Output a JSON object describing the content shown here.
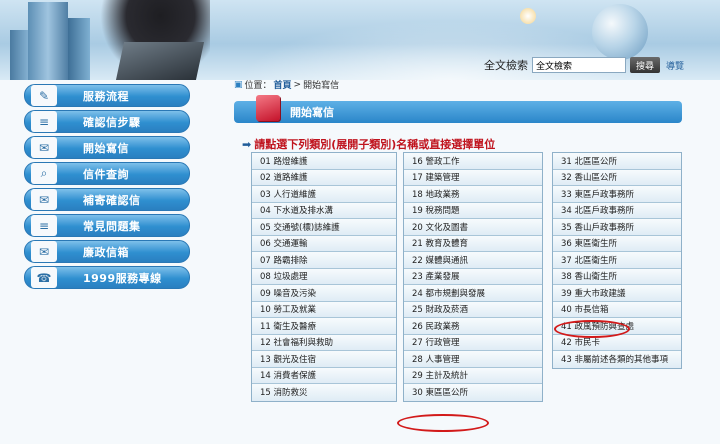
{
  "header": {
    "search_label": "全文檢索",
    "search_value": "全文檢索",
    "search_button": "搜尋",
    "nav_link": "導覽"
  },
  "breadcrumb": {
    "prefix": "位置：",
    "home": "首頁",
    "separator": ">",
    "current": "開始寫信"
  },
  "sidebar": {
    "items": [
      {
        "label": "服務流程",
        "icon": "pencil-icon",
        "glyph": "✎"
      },
      {
        "label": "確認信步驟",
        "icon": "document-icon",
        "glyph": "≡"
      },
      {
        "label": "開始寫信",
        "icon": "envelope-icon",
        "glyph": "✉"
      },
      {
        "label": "信件查詢",
        "icon": "magnifier-icon",
        "glyph": "⌕"
      },
      {
        "label": "補寄確認信",
        "icon": "mailbox-icon",
        "glyph": "✉"
      },
      {
        "label": "常見問題集",
        "icon": "document-icon",
        "glyph": "≡"
      },
      {
        "label": "廉政信箱",
        "icon": "envelope-icon",
        "glyph": "✉"
      },
      {
        "label": "1999服務專線",
        "icon": "phone-icon",
        "glyph": "☎"
      }
    ]
  },
  "main": {
    "title": "開始寫信",
    "instruction_part1": "請點選下列類別(展開子類別)名稱或直接選擇單位",
    "columns": [
      [
        "01 路燈維護",
        "02 道路維護",
        "03 人行道維護",
        "04 下水道及排水溝",
        "05 交通號(標)誌維護",
        "06 交通運輸",
        "07 路霸排除",
        "08 垃圾處理",
        "09 噪音及污染",
        "10 勞工及就業",
        "11 衛生及醫療",
        "12 社會福利與救助",
        "13 觀光及住宿",
        "14 消費者保護",
        "15 消防救災"
      ],
      [
        "16 警政工作",
        "17 建築管理",
        "18 地政業務",
        "19 稅務問題",
        "20 文化及圖書",
        "21 教育及體育",
        "22 媒體與通訊",
        "23 產業發展",
        "24 都市規劃與發展",
        "25 財政及菸酒",
        "26 民政業務",
        "27 行政管理",
        "28 人事管理",
        "29 主計及統計",
        "30 東區區公所"
      ],
      [
        "31 北區區公所",
        "32 香山區公所",
        "33 東區戶政事務所",
        "34 北區戶政事務所",
        "35 香山戶政事務所",
        "36 東區衛生所",
        "37 北區衛生所",
        "38 香山衛生所",
        "39 重大市政建議",
        "40 市長信箱",
        "41 政風預防興查處",
        "42 市民卡",
        "43 非屬前述各類的其他事項"
      ]
    ],
    "highlight_color": "#d21a1a"
  }
}
